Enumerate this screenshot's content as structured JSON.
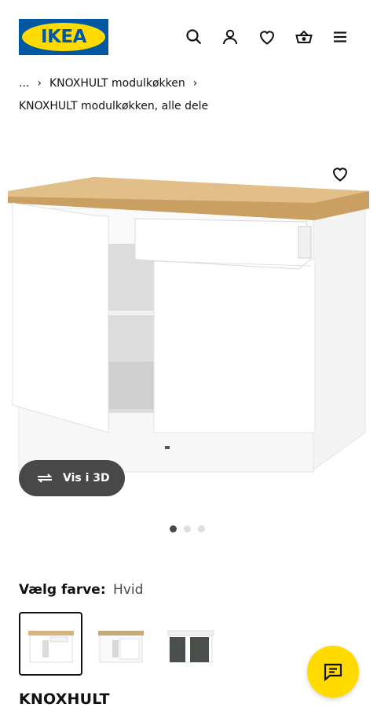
{
  "header": {
    "logo_text": "IKEA",
    "icons": [
      "search-icon",
      "account-icon",
      "favourites-icon",
      "basket-icon",
      "menu-icon"
    ]
  },
  "breadcrumb": {
    "ellipsis": "...",
    "parent": "KNOXHULT modulkøkken",
    "current": "KNOXHULT modulkøkken, alle dele"
  },
  "gallery": {
    "view_3d_label": "Vis i 3D",
    "slides": 3,
    "active_slide": 1
  },
  "color_picker": {
    "label": "Vælg farve:",
    "selected": "Hvid",
    "options": [
      "white-oak-top",
      "white-grey",
      "dark-grey"
    ]
  },
  "product": {
    "name": "KNOXHULT"
  },
  "colors": {
    "logo_blue": "#0058a3",
    "logo_yellow": "#ffdb00",
    "chat_yellow": "#ffdb00",
    "button_dark": "#484848"
  }
}
